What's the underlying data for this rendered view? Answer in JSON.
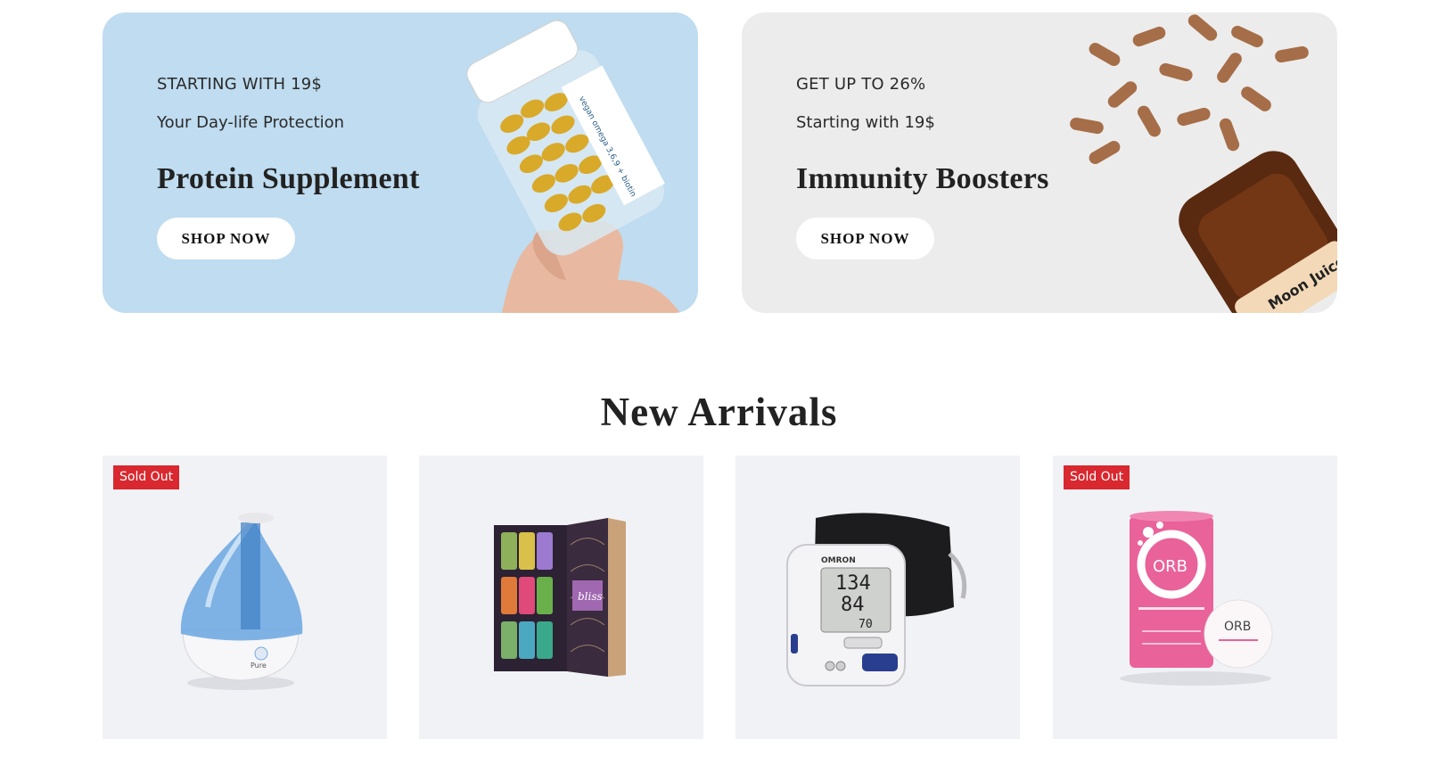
{
  "banners": [
    {
      "kicker": "STARTING WITH 19$",
      "tagline": "Your Day-life Protection",
      "title": "Protein Supplement",
      "button": "SHOP NOW",
      "bg_color": "#bfdcf0",
      "image_label": "vegan omega 3,6,9 + biotin"
    },
    {
      "kicker": "GET UP TO 26%",
      "tagline": "Starting with 19$",
      "title": "Immunity Boosters",
      "button": "SHOP NOW",
      "bg_color": "#ececec",
      "image_label": "Moon Juice"
    }
  ],
  "new_arrivals": {
    "title": "New Arrivals",
    "products": [
      {
        "badge": "Sold Out",
        "image": "humidifier-image",
        "brand": "Pure"
      },
      {
        "badge": "",
        "image": "essential-oils-set-image",
        "brand": "bliss"
      },
      {
        "badge": "",
        "image": "blood-pressure-monitor-image",
        "brand": "OMRON",
        "readout": [
          "134",
          "84",
          "70"
        ]
      },
      {
        "badge": "Sold Out",
        "image": "orb-collagen-image",
        "brand": "ORB"
      }
    ]
  },
  "colors": {
    "sold_out_badge": "#d9282f",
    "card_bg": "#f1f2f6"
  }
}
